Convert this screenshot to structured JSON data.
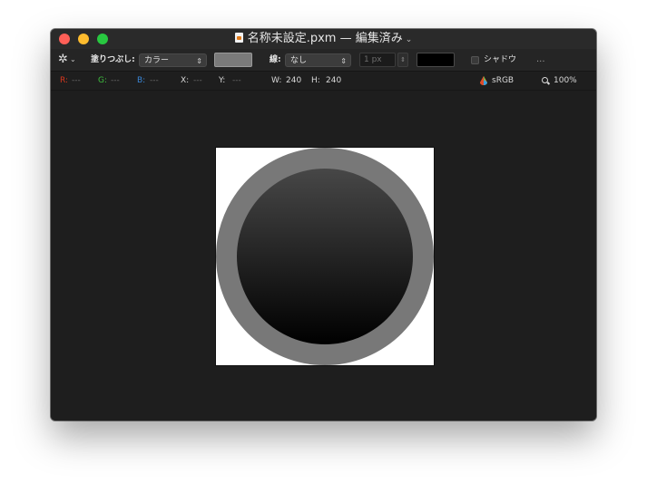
{
  "window": {
    "title": "名称未設定.pxm",
    "separator": "—",
    "status": "編集済み",
    "chevron": "⌄"
  },
  "toolbar": {
    "gear_icon": "✲",
    "gear_chevron": "⌄",
    "fill_label": "塗りつぶし:",
    "fill_value": "カラー",
    "fill_color": "#7a7a7a",
    "stroke_label": "線:",
    "stroke_value": "なし",
    "stroke_width": "1 px",
    "stroke_color": "#000000",
    "shadow_label": "シャドウ",
    "more_label": "..."
  },
  "infobar": {
    "r_label": "R:",
    "r_value": "---",
    "g_label": "G:",
    "g_value": "---",
    "b_label": "B:",
    "b_value": "---",
    "x_label": "X:",
    "x_value": "---",
    "y_label": "Y:",
    "y_value": "---",
    "w_label": "W:",
    "w_value": "240",
    "h_label": "H:",
    "h_value": "240",
    "colorspace": "sRGB",
    "zoom": "100%"
  },
  "colors": {
    "red_label": "#d9381e",
    "green_label": "#3fbf3f",
    "blue_label": "#3a86d6",
    "outer_ring": "#787878",
    "gradient_top": "#474747",
    "gradient_bottom": "#000000"
  }
}
